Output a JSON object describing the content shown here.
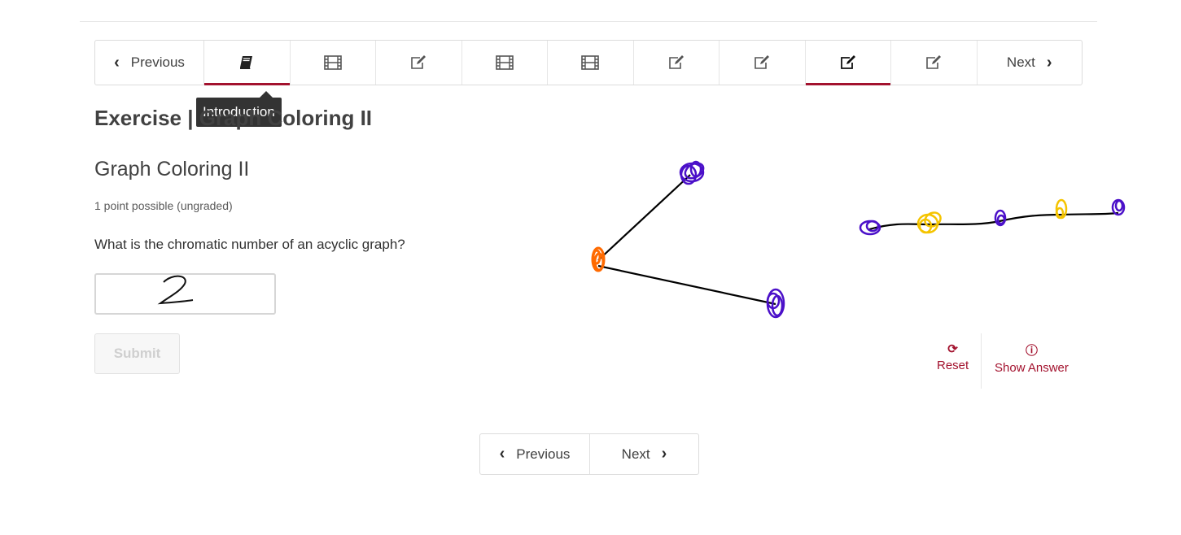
{
  "sequence_nav": {
    "previous_label": "Previous",
    "next_label": "Next",
    "tabs": [
      {
        "icon": "book-icon",
        "active": true
      },
      {
        "icon": "film-icon",
        "active": false
      },
      {
        "icon": "edit-icon",
        "active": false
      },
      {
        "icon": "film-icon",
        "active": false
      },
      {
        "icon": "film-icon",
        "active": false
      },
      {
        "icon": "edit-icon",
        "active": false
      },
      {
        "icon": "edit-icon",
        "active": false
      },
      {
        "icon": "edit-icon",
        "active": true
      },
      {
        "icon": "edit-icon",
        "active": false
      }
    ],
    "tooltip": "Introduction"
  },
  "exercise": {
    "title": "Exercise | Graph Coloring II",
    "problem_title": "Graph Coloring II",
    "points": "1 point possible (ungraded)",
    "question": "What is the chromatic number of an acyclic graph?",
    "answer_value": "2",
    "submit_label": "Submit"
  },
  "actions": {
    "reset_label": "Reset",
    "show_answer_label": "Show Answer"
  },
  "bottom_nav": {
    "previous_label": "Previous",
    "next_label": "Next"
  },
  "colors": {
    "accent": "#a3122e",
    "purple": "#4b10c9",
    "orange": "#ff6a00",
    "yellow": "#f5c400"
  }
}
